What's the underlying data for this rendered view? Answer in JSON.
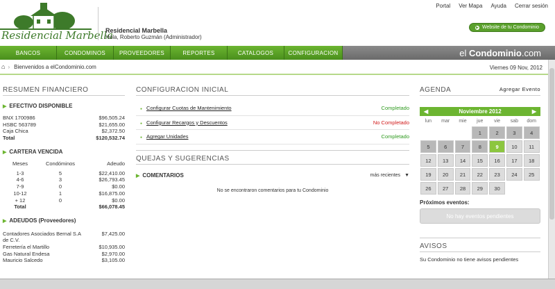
{
  "header": {
    "logo_text": "Residencial Marbella",
    "condo_name": "Residencial Marbella",
    "greeting": "Hola, Roberto Guzmán (Administrador)",
    "links": [
      "Portal",
      "Ver Mapa",
      "Ayuda",
      "Cerrar sesión"
    ],
    "website_button": "Website de tu Condominio"
  },
  "nav": {
    "items": [
      "BANCOS",
      "CONDOMINOS",
      "PROVEEDORES",
      "REPORTES",
      "CATALOGOS",
      "CONFIGURACION"
    ],
    "brand_prefix": "el ",
    "brand_bold": "Condominio",
    "brand_suffix": ".com"
  },
  "breadcrumb": {
    "current": "Bienvenidos a elCondominio.com",
    "date": "Viernes 09 Nov, 2012"
  },
  "financial": {
    "title": "RESUMEN FINANCIERO",
    "cash": {
      "title": "EFECTIVO DISPONIBLE",
      "rows": [
        {
          "label": "BNX 1700986",
          "value": "$96,505.24"
        },
        {
          "label": "HSBC 563789",
          "value": "$21,655.00"
        },
        {
          "label": "Caja Chica",
          "value": "$2,372.50"
        },
        {
          "label": "Total",
          "value": "$120,532.74"
        }
      ]
    },
    "overdue": {
      "title": "CARTERA VENCIDA",
      "headers": [
        "Meses",
        "Condóminos",
        "Adeudo"
      ],
      "rows": [
        [
          "1-3",
          "5",
          "$22,410.00"
        ],
        [
          "4-6",
          "3",
          "$26,793.45"
        ],
        [
          "7-9",
          "0",
          "$0.00"
        ],
        [
          "10-12",
          "1",
          "$16,875.00"
        ],
        [
          "+ 12",
          "0",
          "$0.00"
        ],
        [
          "Total",
          "",
          "$66,078.45"
        ]
      ]
    },
    "debts": {
      "title": "ADEUDOS (Proveedores)",
      "rows": [
        {
          "label": "Contadores Asociados Bernal S.A de C.V.",
          "value": "$7,425.00"
        },
        {
          "label": "Ferretería el Martillo",
          "value": "$10,935.00"
        },
        {
          "label": "Gas Natural Endesa",
          "value": "$2,970.00"
        },
        {
          "label": "Mauricio Salcedo",
          "value": "$3,105.00"
        }
      ]
    }
  },
  "config": {
    "title": "CONFIGURACION INICIAL",
    "items": [
      {
        "label": "Configurar Cuotas de Mantenimiento",
        "status": "Completado",
        "color": "#2e9a1e"
      },
      {
        "label": "Configurar Recargos y Descuentos",
        "status": "No Completado",
        "color": "#d11a1a"
      },
      {
        "label": "Agregar Unidades",
        "status": "Completado",
        "color": "#2e9a1e"
      }
    ]
  },
  "complaints": {
    "title": "QUEJAS Y SUGERENCIAS",
    "comments_title": "COMENTARIOS",
    "sort": "más recientes",
    "empty": "No se encontraron comentarios para tu Condominio"
  },
  "agenda": {
    "title": "AGENDA",
    "add": "Agregar Evento",
    "month": "Noviembre 2012",
    "dow": [
      "lun",
      "mar",
      "mie",
      "jue",
      "vie",
      "sab",
      "dom"
    ],
    "days": [
      "",
      "",
      "",
      "1",
      "2",
      "3",
      "4",
      "5",
      "6",
      "7",
      "8",
      "9",
      "10",
      "11",
      "12",
      "13",
      "14",
      "15",
      "16",
      "17",
      "18",
      "19",
      "20",
      "21",
      "22",
      "23",
      "24",
      "25",
      "26",
      "27",
      "28",
      "29",
      "30",
      "",
      ""
    ],
    "today": "9",
    "upcoming_title": "Próximos eventos:",
    "no_events": "No hay eventos pendientes"
  },
  "notices": {
    "title": "AVISOS",
    "empty": "Su Condominio no tiene avisos pendientes"
  }
}
